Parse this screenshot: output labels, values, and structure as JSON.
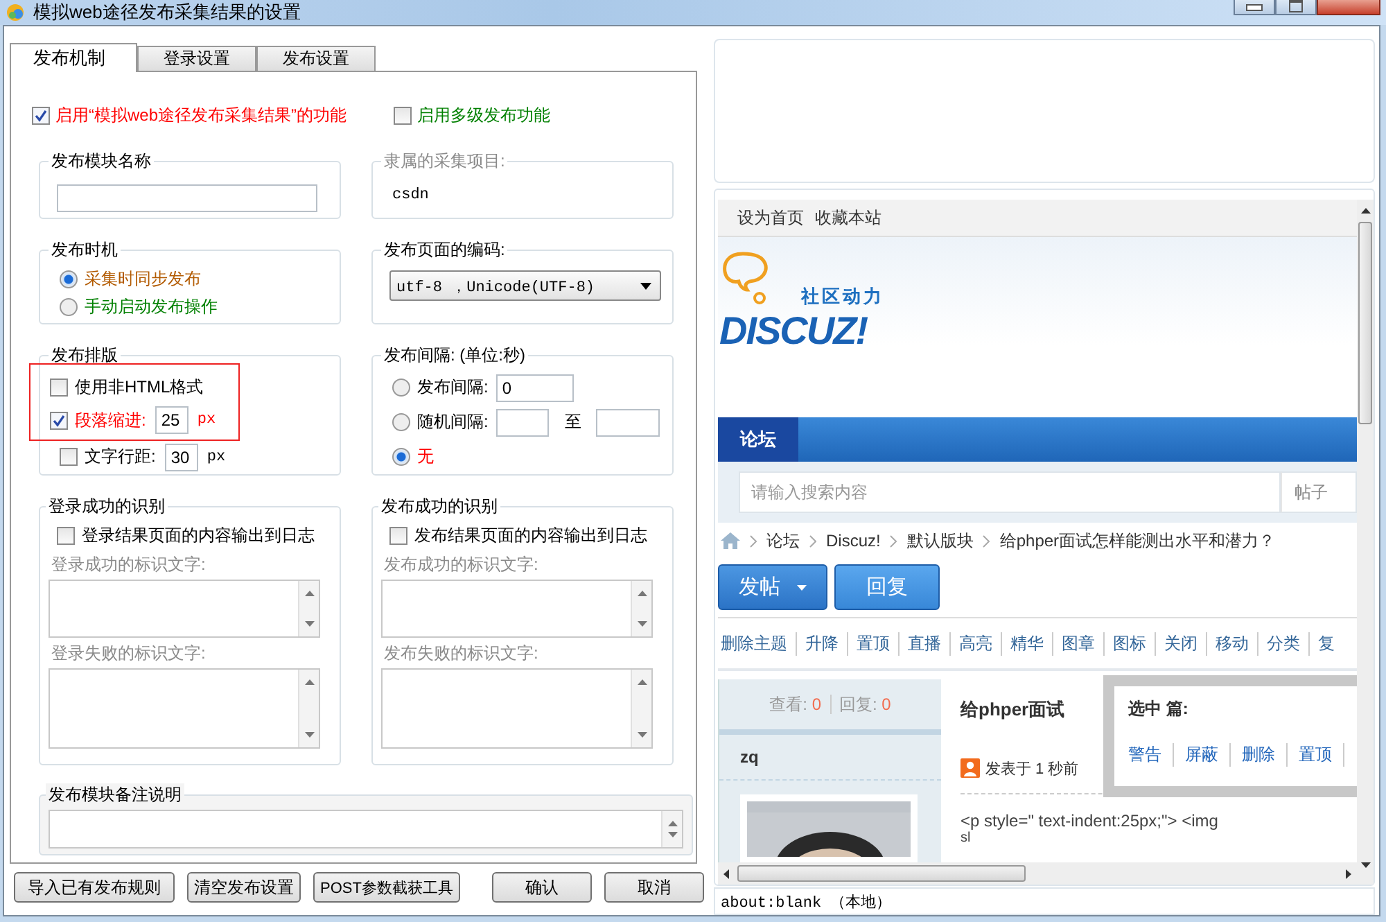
{
  "window": {
    "title": "模拟web途径发布采集结果的设置"
  },
  "tabs": [
    {
      "label": "发布机制",
      "selected": true
    },
    {
      "label": "登录设置",
      "selected": false
    },
    {
      "label": "发布设置",
      "selected": false
    }
  ],
  "top_options": [
    {
      "label": "启用“模拟web途径发布采集结果”的功能",
      "checked": true,
      "color": "#ff0000"
    },
    {
      "label": "启用多级发布功能",
      "checked": false,
      "color": "#008000"
    }
  ],
  "module_name": {
    "title": "发布模块名称"
  },
  "project": {
    "title": "隶属的采集项目:",
    "value": "csdn"
  },
  "timing": {
    "title": "发布时机",
    "options": [
      {
        "label": "采集时同步发布",
        "selected": true,
        "color": "#b25a00"
      },
      {
        "label": "手动启动发布操作",
        "selected": false,
        "color": "#008000"
      }
    ]
  },
  "encoding": {
    "title": "发布页面的编码:",
    "value": "utf-8 ，Unicode(UTF-8)"
  },
  "layout": {
    "title": "发布排版",
    "options": [
      {
        "label": "使用非HTML格式",
        "checked": false,
        "color": "#000000",
        "highlighted": true
      },
      {
        "label": "段落缩进:",
        "checked": true,
        "color": "#ff0000",
        "value": "25",
        "unit": "px",
        "highlighted": true
      },
      {
        "label": "文字行距:",
        "checked": false,
        "color": "#000000",
        "value": "30",
        "unit": "px",
        "highlighted": false
      }
    ]
  },
  "interval": {
    "title": "发布间隔: (单位:秒)",
    "options": [
      {
        "kind": "single",
        "label": "发布间隔:",
        "selected": false,
        "color": "#000000",
        "value": "0"
      },
      {
        "kind": "range",
        "label": "随机间隔:",
        "selected": false,
        "color": "#000000",
        "separator": "至"
      },
      {
        "kind": "plain",
        "label": "无",
        "selected": true,
        "color": "#ff0000"
      }
    ]
  },
  "detections": [
    {
      "title": "登录成功的识别",
      "log_option": {
        "label": "登录结果页面的内容输出到日志",
        "checked": false
      },
      "success_label": "登录成功的标识文字:",
      "failure_label": "登录失败的标识文字:"
    },
    {
      "title": "发布成功的识别",
      "log_option": {
        "label": "发布结果页面的内容输出到日志",
        "checked": false
      },
      "success_label": "发布成功的标识文字:",
      "failure_label": "发布失败的标识文字:"
    }
  ],
  "notes": {
    "title": "发布模块备注说明"
  },
  "buttons": [
    "导入已有发布规则",
    "清空发布设置",
    "POST参数截获工具",
    "确认",
    "取消"
  ],
  "browser": {
    "top_links": [
      "设为首页",
      "收藏本站"
    ],
    "logo": {
      "tagline": "社区动力",
      "wordmark": "DISCUZ!"
    },
    "nav": [
      {
        "label": "论坛",
        "selected": true
      }
    ],
    "search": {
      "placeholder": "请输入搜索内容",
      "scope": "帖子"
    },
    "breadcrumb": [
      "论坛",
      "Discuz!",
      "默认版块",
      "给phper面试怎样能测出水平和潜力？"
    ],
    "actions": [
      {
        "label": "发帖",
        "kind": "dropdown"
      },
      {
        "label": "回复",
        "kind": "plain"
      }
    ],
    "mod_links": [
      "删除主题",
      "升降",
      "置顶",
      "直播",
      "高亮",
      "精华",
      "图章",
      "图标",
      "关闭",
      "移动",
      "分类",
      "复"
    ],
    "stats": {
      "views_label": "查看:",
      "views": "0",
      "replies_label": "回复:",
      "replies": "0"
    },
    "author": "zq",
    "post": {
      "title": "给phper面试",
      "posted": "发表于 1 秒前",
      "lines": [
        "<p style=\" text-indent:25px;\"> <img",
        "sl"
      ]
    },
    "popup": {
      "title": "选中 篇:",
      "links": [
        "警告",
        "屏蔽",
        "删除",
        "置顶"
      ]
    }
  },
  "status": "about:blank （本地）"
}
